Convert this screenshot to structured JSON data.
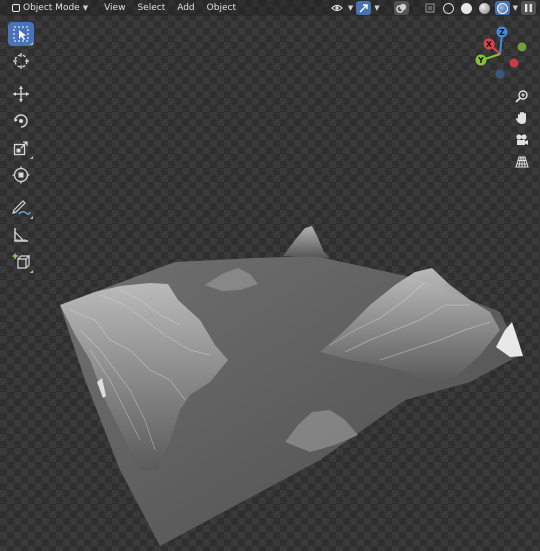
{
  "header": {
    "mode_label": "Object Mode",
    "menus": [
      "View",
      "Select",
      "Add",
      "Object"
    ]
  },
  "gizmo": {
    "x": "X",
    "y": "Y",
    "z": "Z"
  },
  "colors": {
    "accent": "#4772b3",
    "axis_x": "#e0404c",
    "axis_y": "#86c13a",
    "axis_z": "#3f8bdc"
  },
  "toolbar": {
    "tools": [
      "select-box-icon",
      "cursor-icon",
      "move-icon",
      "rotate-icon",
      "scale-icon",
      "transform-icon",
      "annotate-icon",
      "measure-icon",
      "add-cube-icon"
    ],
    "active": "select-box-icon"
  },
  "navigation": [
    "zoom-icon",
    "hand-pan-icon",
    "camera-icon",
    "grid-perspective-icon"
  ]
}
